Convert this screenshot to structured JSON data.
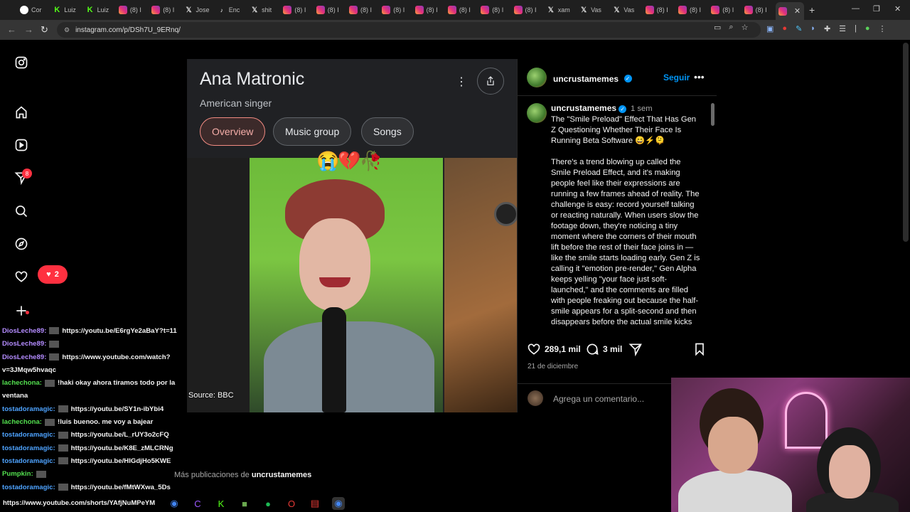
{
  "browser": {
    "tabs": [
      {
        "icon": "chrome-icon",
        "label": "Cor"
      },
      {
        "icon": "kick-icon",
        "label": "Luiz"
      },
      {
        "icon": "kick-icon",
        "label": "Luiz"
      },
      {
        "icon": "instagram-icon",
        "label": "(8) I"
      },
      {
        "icon": "instagram-icon",
        "label": "(8) I"
      },
      {
        "icon": "x-icon",
        "label": "Jose"
      },
      {
        "icon": "tiktok-icon",
        "label": "Enc"
      },
      {
        "icon": "x-icon",
        "label": "shit"
      },
      {
        "icon": "instagram-icon",
        "label": "(8) I"
      },
      {
        "icon": "instagram-icon",
        "label": "(8) I"
      },
      {
        "icon": "instagram-icon",
        "label": "(8) I"
      },
      {
        "icon": "instagram-icon",
        "label": "(8) I"
      },
      {
        "icon": "instagram-icon",
        "label": "(8) I"
      },
      {
        "icon": "instagram-icon",
        "label": "(8) I"
      },
      {
        "icon": "instagram-icon",
        "label": "(8) I"
      },
      {
        "icon": "instagram-icon",
        "label": "(8) I"
      },
      {
        "icon": "x-icon",
        "label": "xam"
      },
      {
        "icon": "x-icon",
        "label": "Vas"
      },
      {
        "icon": "x-icon",
        "label": "Vas"
      },
      {
        "icon": "instagram-icon",
        "label": "(8) I"
      },
      {
        "icon": "instagram-icon",
        "label": "(8) I"
      },
      {
        "icon": "instagram-icon",
        "label": "(8) I"
      },
      {
        "icon": "instagram-icon",
        "label": "(8) I"
      }
    ],
    "active_tab_close": "✕",
    "new_tab": "+",
    "url": "instagram.com/p/DSh7U_9ERnq/",
    "win_minimize": "—",
    "win_restore": "❐",
    "win_close": "✕"
  },
  "knowledge_panel": {
    "title": "Ana Matronic",
    "subtitle": "American singer",
    "chips": [
      "Overview",
      "Music group",
      "Songs"
    ],
    "active_chip": "Overview",
    "emojis": "😭💔🥀",
    "source": "Source: BBC"
  },
  "post": {
    "username": "uncrustamemes",
    "follow_label": "Seguir",
    "time": "1 sem",
    "caption_title": "The \"Smile Preload\" Effect That Has Gen Z Questioning Whether Their Face Is Running Beta Software 😄⚡🫠",
    "caption_body": "There's a trend blowing up called the Smile Preload Effect, and it's making people feel like their expressions are running a few frames ahead of reality. The challenge is easy: record yourself talking or reacting naturally. When users slow the footage down, they're noticing a tiny moment where the corners of their mouth lift before the rest of their face joins in — like the smile starts loading early. Gen Z is calling it \"emotion pre-render,\" Gen Alpha keeps yelling \"your face just soft-launched,\" and the comments are filled with people freaking out because the half-smile appears for a split-second and then disappears before the actual smile kicks",
    "likes": "289,1 mil",
    "comments": "3 mil",
    "date": "21 de diciembre",
    "comment_placeholder": "Agrega un comentario...",
    "more_posts_prefix": "Más publicaciones de",
    "more_posts_user": "uncrustamemes"
  },
  "sidebar": {
    "notifications_badge": "8",
    "likes_pill": "2"
  },
  "chat": [
    {
      "user": "DiosLeche89",
      "color": "#b48cff",
      "msg": "https://youtu.be/E6rgYe2aBaY?t=11"
    },
    {
      "user": "DiosLeche89",
      "color": "#b48cff",
      "msg": ""
    },
    {
      "user": "DiosLeche89",
      "color": "#b48cff",
      "msg": "https://www.youtube.com/watch?"
    },
    {
      "user": "",
      "color": "#b48cff",
      "msg": "v=3JMqw5hvaqc"
    },
    {
      "user": "lachechona",
      "color": "#53e04f",
      "msg": "!haki okay ahora tiramos todo por la"
    },
    {
      "user": "",
      "color": "#53e04f",
      "msg": "ventana"
    },
    {
      "user": "tostadoramagic",
      "color": "#4ea3ff",
      "msg": "https://youtu.be/SY1n-ibYbi4"
    },
    {
      "user": "lachechona",
      "color": "#53e04f",
      "msg": "!luis buenoo. me voy a bajear"
    },
    {
      "user": "tostadoramagic",
      "color": "#4ea3ff",
      "msg": "https://youtu.be/L_rUY3o2cFQ"
    },
    {
      "user": "tostadoramagic",
      "color": "#4ea3ff",
      "msg": "https://youtu.be/K8E_zMLCRNg"
    },
    {
      "user": "tostadoramagic",
      "color": "#4ea3ff",
      "msg": "https://youtu.be/HIGdjHo5KWE"
    },
    {
      "user": "Pumpkin",
      "color": "#53e04f",
      "msg": ""
    },
    {
      "user": "tostadoramagic",
      "color": "#4ea3ff",
      "msg": "https://youtu.be/fMtWXwa_5Ds"
    }
  ],
  "taskbar": {
    "status_url": "https://www.youtube.com/shorts/YAfjNuMPeYM"
  },
  "colors": {
    "instagram_blue": "#0095f6",
    "notification_red": "#ff3040",
    "chip_active": "#f28b82"
  }
}
